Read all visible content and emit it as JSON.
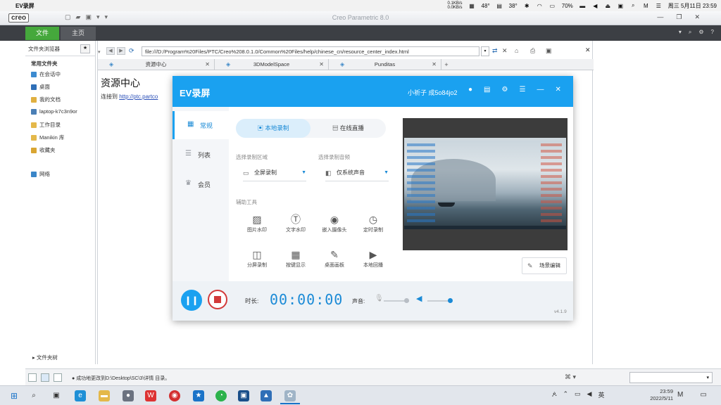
{
  "mac_bar": {
    "apple": "",
    "app_name": "EV录屏",
    "net_up": "0.1KB/s",
    "net_down": "0.0KB/s",
    "temp1": "48°",
    "temp2": "38°",
    "battery": "70%",
    "datetime": "周三 5月11日 23:59"
  },
  "creo": {
    "logo": "creo",
    "title": "Creo Parametric 8.0",
    "ribbon_tabs": [
      "文件",
      "主页"
    ],
    "navigator": {
      "tab_label": "文件夹浏览器",
      "section": "常用文件夹",
      "items": [
        "在会话中",
        "桌面",
        "我的文档",
        "laptop-k7c3n9or",
        "工作目录",
        "Manikin 库",
        "收藏夹",
        "网络"
      ],
      "bottom": "文件夹树"
    },
    "browser": {
      "address": "file:///D:/Program%20Files/PTC/Creo%208.0.1.0/Common%20Files/help/chinese_cn/resource_center_index.html",
      "tabs": [
        "资源中心",
        "3DModelSpace",
        "Punditas"
      ],
      "page_heading": "资源中心",
      "page_text": "连接到",
      "page_link": "http://ptc.partco"
    },
    "status_message": "成功地更改到D:\\Desktop\\SC\\3\\详情 目录。"
  },
  "ev": {
    "title": "EV录屏",
    "user": "小祈子 成5o84jo2",
    "sidebar": [
      "常规",
      "列表",
      "会员"
    ],
    "mode_tabs": [
      "本地录制",
      "在线直播"
    ],
    "area_label": "选择录制区域",
    "area_value": "全屏录制",
    "audio_label": "选择录制音频",
    "audio_value": "仅系统声音",
    "tools_label": "辅助工具",
    "tools": [
      "图片水印",
      "文字水印",
      "嵌入摄像头",
      "定时录制",
      "分屏录制",
      "按键显示",
      "桌面画板",
      "本地回播"
    ],
    "scene_button": "场景编辑",
    "duration_label": "时长:",
    "duration": "00:00:00",
    "sound_label": "声音:",
    "mic_volume": 0.9,
    "speaker_volume": 1.0,
    "version": "v4.1.9"
  },
  "taskbar": {
    "time": "23:59",
    "date": "2022/5/11",
    "ime": "英",
    "apps": [
      "search-icon",
      "task-view-icon",
      "edge-icon",
      "explorer-icon",
      "app-icon",
      "wps-icon",
      "netease-icon",
      "store-icon",
      "wechat-icon",
      "ev-recorder-icon",
      "photos-icon",
      "creo-icon"
    ]
  }
}
